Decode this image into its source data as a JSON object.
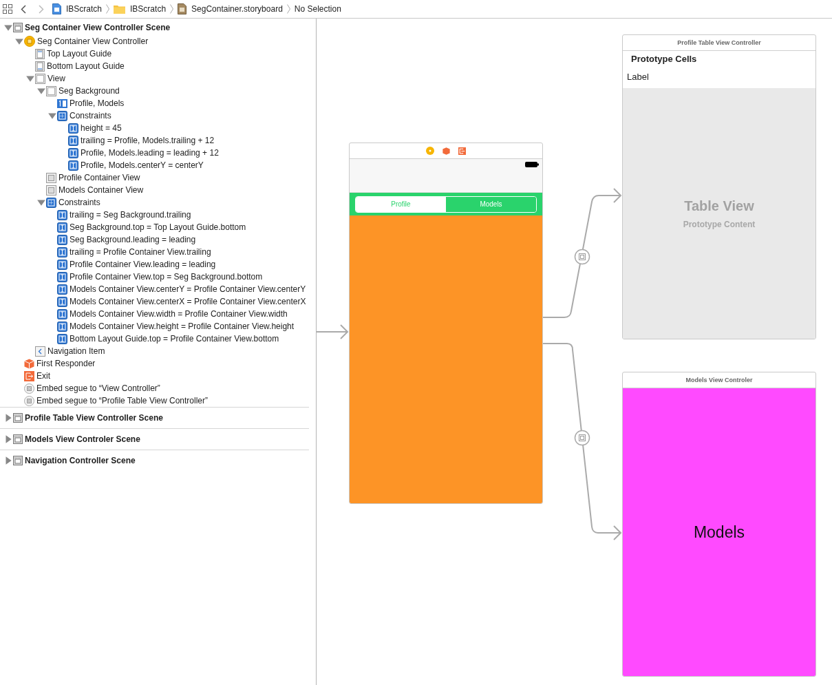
{
  "breadcrumbs": [
    {
      "label": "IBScratch",
      "kind": "project"
    },
    {
      "label": "IBScratch",
      "kind": "folder"
    },
    {
      "label": "SegContainer.storyboard",
      "kind": "storyboard"
    },
    {
      "label": "No Selection",
      "kind": "plain"
    }
  ],
  "outline": [
    {
      "label": "Seg Container View Controller Scene",
      "kind": "scene",
      "expanded": true,
      "children": [
        {
          "label": "Seg Container View Controller",
          "kind": "controller",
          "expanded": true,
          "children": [
            {
              "label": "Top Layout Guide",
              "kind": "top-guide"
            },
            {
              "label": "Bottom Layout Guide",
              "kind": "bottom-guide"
            },
            {
              "label": "View",
              "kind": "view",
              "expanded": true,
              "children": [
                {
                  "label": "Seg Background",
                  "kind": "view",
                  "expanded": true,
                  "children": [
                    {
                      "label": "Profile, Models",
                      "kind": "segmented"
                    },
                    {
                      "label": "Constraints",
                      "kind": "constraints",
                      "expanded": true,
                      "children": [
                        {
                          "label": "height = 45",
                          "kind": "constraint"
                        },
                        {
                          "label": "trailing = Profile, Models.trailing + 12",
                          "kind": "constraint"
                        },
                        {
                          "label": "Profile, Models.leading = leading + 12",
                          "kind": "constraint"
                        },
                        {
                          "label": "Profile, Models.centerY = centerY",
                          "kind": "constraint"
                        }
                      ]
                    }
                  ]
                },
                {
                  "label": "Profile Container View",
                  "kind": "container"
                },
                {
                  "label": "Models Container View",
                  "kind": "container"
                },
                {
                  "label": "Constraints",
                  "kind": "constraints",
                  "expanded": true,
                  "children": [
                    {
                      "label": "trailing = Seg Background.trailing",
                      "kind": "constraint"
                    },
                    {
                      "label": "Seg Background.top = Top Layout Guide.bottom",
                      "kind": "constraint"
                    },
                    {
                      "label": "Seg Background.leading = leading",
                      "kind": "constraint"
                    },
                    {
                      "label": "trailing = Profile Container View.trailing",
                      "kind": "constraint"
                    },
                    {
                      "label": "Profile Container View.leading = leading",
                      "kind": "constraint"
                    },
                    {
                      "label": "Profile Container View.top = Seg Background.bottom",
                      "kind": "constraint"
                    },
                    {
                      "label": "Models Container View.centerY = Profile Container View.centerY",
                      "kind": "constraint"
                    },
                    {
                      "label": "Models Container View.centerX = Profile Container View.centerX",
                      "kind": "constraint"
                    },
                    {
                      "label": "Models Container View.width = Profile Container View.width",
                      "kind": "constraint"
                    },
                    {
                      "label": "Models Container View.height = Profile Container View.height",
                      "kind": "constraint"
                    },
                    {
                      "label": "Bottom Layout Guide.top = Profile Container View.bottom",
                      "kind": "constraint"
                    }
                  ]
                }
              ]
            },
            {
              "label": "Navigation Item",
              "kind": "nav-item"
            }
          ]
        },
        {
          "label": "First Responder",
          "kind": "responder"
        },
        {
          "label": "Exit",
          "kind": "exit"
        },
        {
          "label": "Embed segue to “View Controller”",
          "kind": "segue"
        },
        {
          "label": "Embed segue to “Profile Table View Controller”",
          "kind": "segue"
        }
      ]
    },
    {
      "label": "Profile Table View Controller Scene",
      "kind": "scene",
      "expanded": false
    },
    {
      "label": "Models View Controler Scene",
      "kind": "scene",
      "expanded": false
    },
    {
      "label": "Navigation Controller Scene",
      "kind": "scene",
      "expanded": false
    }
  ],
  "canvas": {
    "scenes": [
      {
        "kind": "container",
        "color": "#fd9426",
        "segments": [
          {
            "label": "Profile",
            "selected": true
          },
          {
            "label": "Models",
            "selected": false
          }
        ]
      },
      {
        "kind": "table",
        "title": "Profile Table View Controller",
        "section_header": "Prototype Cells",
        "cell_label": "Label",
        "placeholder_title": "Table View",
        "placeholder_subtitle": "Prototype Content"
      },
      {
        "kind": "plain",
        "title": "Models View Controler",
        "label": "Models",
        "color": "#ff4aff"
      }
    ]
  }
}
